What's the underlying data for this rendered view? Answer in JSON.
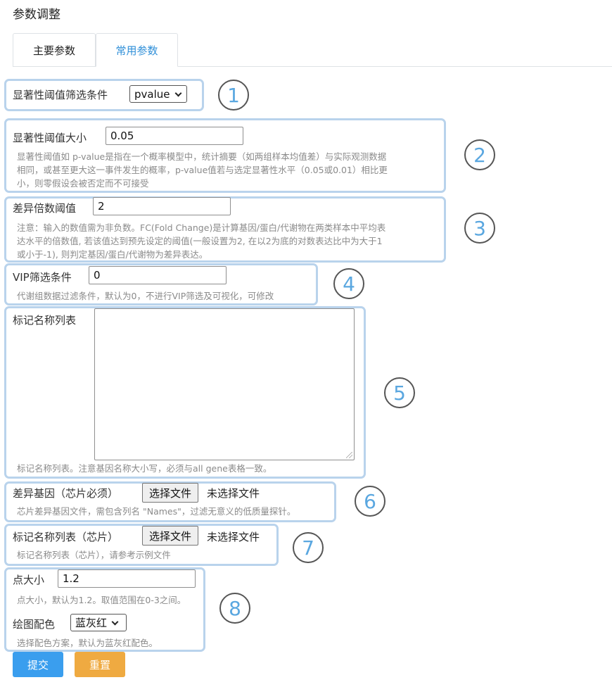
{
  "page": {
    "title": "参数调整"
  },
  "tabs": [
    {
      "label": "主要参数",
      "active": false
    },
    {
      "label": "常用参数",
      "active": true
    }
  ],
  "fields": {
    "significance_filter": {
      "label": "显著性阈值筛选条件",
      "value": "pvalue"
    },
    "significance_threshold": {
      "label": "显著性阈值大小",
      "value": "0.05",
      "help": [
        "显著性阈值如 p-value是指在一个概率模型中，统计摘要（如两组样本均值差）与实际观测数据",
        "相同，或甚至更大这一事件发生的概率，p-value值若与选定显著性水平（0.05或0.01）相比更",
        "小，则零假设会被否定而不可接受"
      ]
    },
    "fold_change": {
      "label": "差异倍数阈值",
      "value": "2",
      "help": [
        "注意：输入的数值需为非负数。FC(Fold Change)是计算基因/蛋白/代谢物在两类样本中平均表",
        "达水平的倍数值, 若该值达到预先设定的阈值(一般设置为2, 在以2为底的对数表达比中为大于1",
        "或小于-1), 则判定基因/蛋白/代谢物为差异表达。"
      ]
    },
    "vip_filter": {
      "label": "VIP筛选条件",
      "value": "0",
      "help": "代谢组数据过滤条件，默认为0，不进行VIP筛选及可视化，可修改"
    },
    "marker_list": {
      "label": "标记名称列表",
      "value": "",
      "help": "标记名称列表。注意基因名称大小写，必须与all gene表格一致。"
    },
    "diff_genes_chip": {
      "label": "差异基因（芯片必须）",
      "button": "选择文件",
      "status": "未选择文件",
      "help": "芯片差异基因文件，需包含列名 \"Names\"，过滤无意义的低质量探针。"
    },
    "marker_list_chip": {
      "label": "标记名称列表（芯片）",
      "button": "选择文件",
      "status": "未选择文件",
      "help": "标记名称列表（芯片），请参考示例文件"
    },
    "point_size": {
      "label": "点大小",
      "value": "1.2",
      "help": "点大小，默认为1.2。取值范围在0-3之间。"
    },
    "color_scheme": {
      "label": "绘图配色",
      "value": "蓝灰红",
      "help": "选择配色方案，默认为蓝灰红配色。"
    }
  },
  "badges": [
    "1",
    "2",
    "3",
    "4",
    "5",
    "6",
    "7",
    "8"
  ],
  "actions": {
    "submit": "提交",
    "reset": "重置"
  },
  "colors": {
    "panel_border": "#b9d3ec",
    "accent": "#2f8fd8",
    "submit": "#3a9eee",
    "reset": "#efaa41",
    "badge_digit": "#5aa7e0"
  }
}
